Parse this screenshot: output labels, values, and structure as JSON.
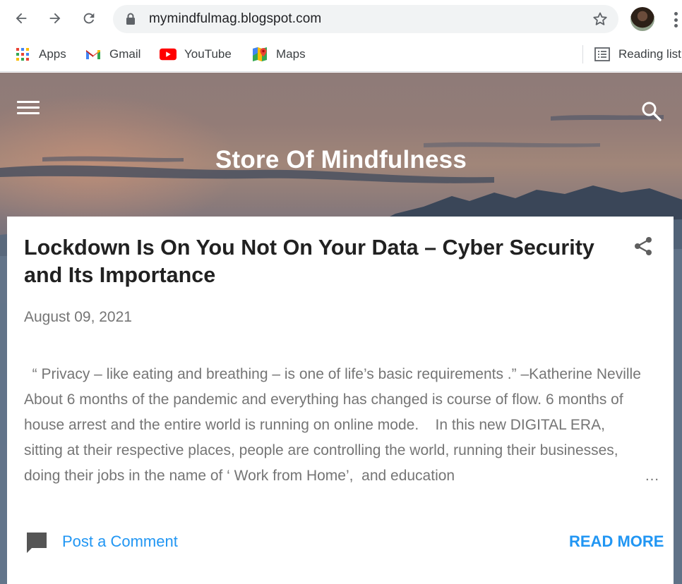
{
  "browser": {
    "url": "mymindfulmag.blogspot.com",
    "bookmarks": [
      {
        "label": "Apps",
        "icon": "apps-grid-icon"
      },
      {
        "label": "Gmail",
        "icon": "gmail-icon"
      },
      {
        "label": "YouTube",
        "icon": "youtube-icon"
      },
      {
        "label": "Maps",
        "icon": "maps-icon"
      }
    ],
    "reading_list": "Reading list"
  },
  "blog": {
    "title": "Store Of Mindfulness"
  },
  "post": {
    "title": "Lockdown Is On You Not On Your Data – Cyber Security and Its Importance",
    "date": "August 09, 2021",
    "snippet": "  “ Privacy – like eating and breathing – is one of life’s basic requirements .” –Katherine Neville   About 6 months of the pandemic and everything has changed is course of flow. 6 months of house arrest and the entire world is running on online mode.    In this new DIGITAL ERA, sitting at their respective places, people are controlling the world, running their businesses, doing their jobs in the name of ‘ Work from Home’,  and education",
    "ellipsis": "…",
    "comment_label": "Post a Comment",
    "read_more_label": "READ MORE"
  },
  "colors": {
    "link": "#2196f3",
    "title_text": "#212121",
    "meta_text": "#757575"
  }
}
